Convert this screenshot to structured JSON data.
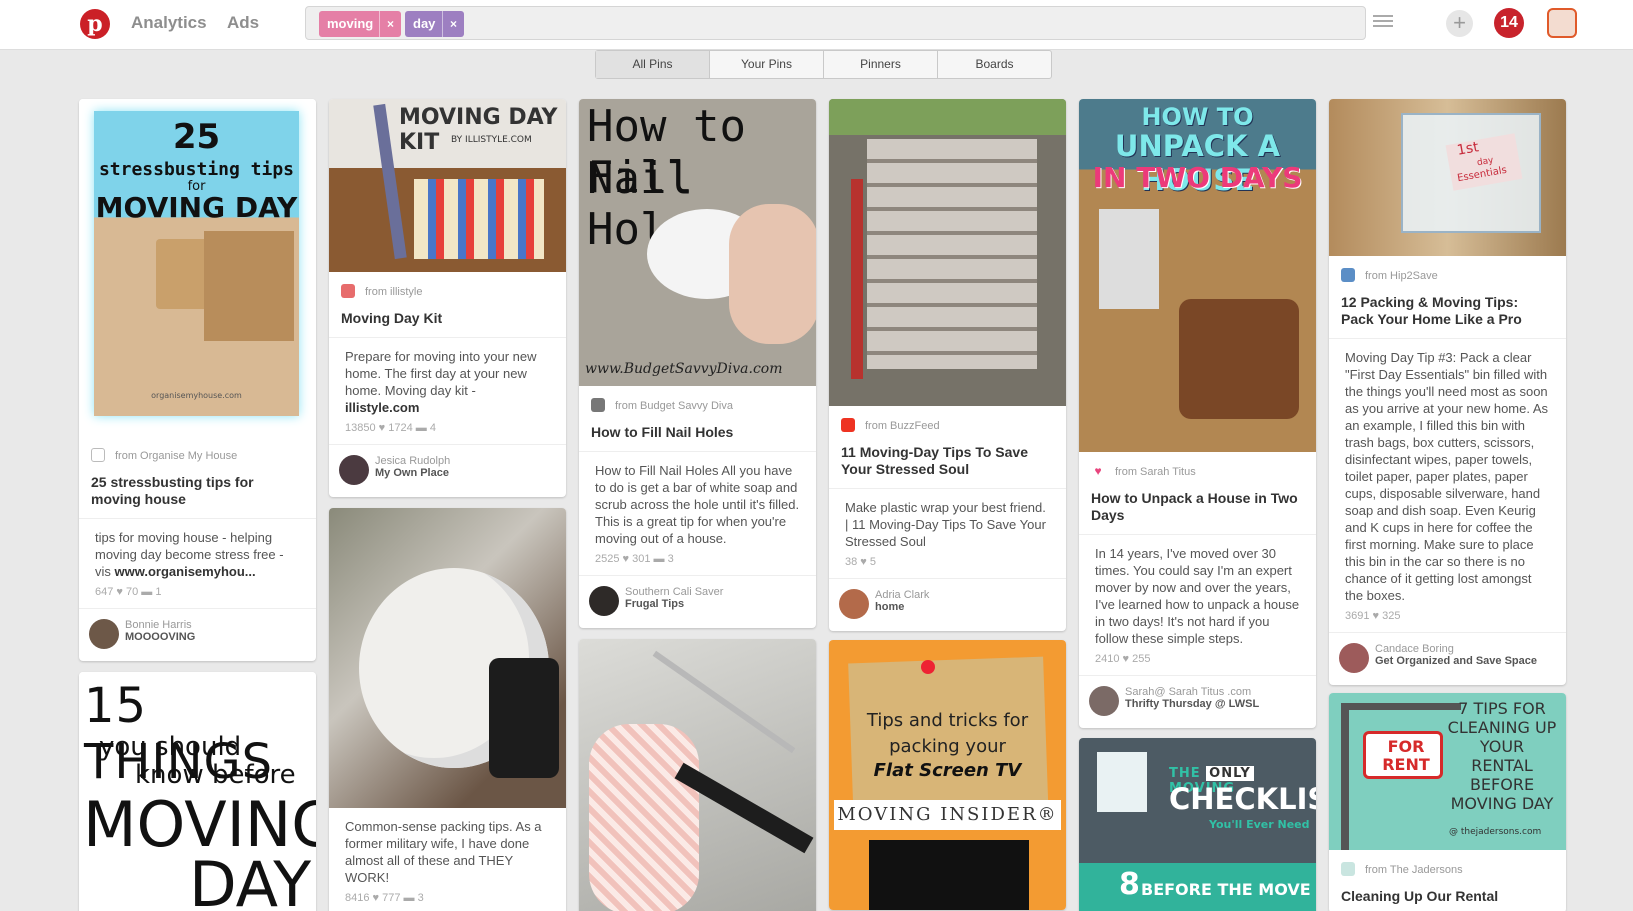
{
  "header": {
    "nav": {
      "analytics": "Analytics",
      "ads": "Ads"
    },
    "search_chips": [
      {
        "label": "moving",
        "color": "#e57fa6"
      },
      {
        "label": "day",
        "color": "#9d7fc1"
      }
    ],
    "notifications": "14",
    "logo_glyph": "p",
    "close_glyph": "×",
    "plus_glyph": "+"
  },
  "tabs": [
    "All Pins",
    "Your Pins",
    "Pinners",
    "Boards"
  ],
  "pins": {
    "p1": {
      "img_title1": "25",
      "img_title2": "stressbusting tips",
      "img_title3": "for",
      "img_title4": "MOVING DAY",
      "img_credit": "organisemyhouse.com",
      "source": "from Organise My House",
      "title": "25 stressbusting tips for moving house",
      "desc": "tips for moving house - helping moving day become stress free - vis ",
      "desc_link": "www.organisemyhou...",
      "stats": "647   ♥ 70   ▬ 1",
      "pinner": "Bonnie Harris",
      "board": "MOOOOVING"
    },
    "p2": {
      "img_title1": "15 THINGS",
      "img_title2": "you should",
      "img_title3": "know before",
      "img_title4": "MOVING",
      "img_title5": "DAY"
    },
    "p3": {
      "img_title1": "MOVING DAY KIT",
      "img_title2": "BY ILLISTYLE.COM",
      "source": "from illistyle",
      "title": "Moving Day Kit",
      "desc": "Prepare for moving into your new home. The first day at your new home. Moving day kit - ",
      "desc_link": "illistyle.com",
      "stats": "13850   ♥ 1724   ▬ 4",
      "pinner": "Jesica Rudolph",
      "board": "My Own Place"
    },
    "p4": {
      "desc": "Common-sense packing tips. As a former military wife, I have done almost all of these and THEY WORK!",
      "stats": "8416   ♥ 777   ▬ 3"
    },
    "p5": {
      "img_title1": "How to Fill",
      "img_title2": "Nail Holes",
      "img_credit": "www.BudgetSavvyDiva.com",
      "source": "from Budget Savvy Diva",
      "title": "How to Fill Nail Holes",
      "desc": "How to Fill Nail Holes All you have to do is get a bar of white soap and scrub across the hole until it's filled. This is a great tip for when you're moving out of a house.",
      "stats": "2525   ♥ 301   ▬ 3",
      "pinner": "Southern Cali Saver",
      "board": "Frugal Tips"
    },
    "p7": {
      "source": "from BuzzFeed",
      "title": "11 Moving-Day Tips To Save Your Stressed Soul",
      "desc": "Make plastic wrap your best friend. | 11 Moving-Day Tips To Save Your Stressed Soul",
      "stats": "38   ♥ 5",
      "pinner": "Adria Clark",
      "board": "home"
    },
    "p8": {
      "img_title1": "Tips and tricks for",
      "img_title2": "packing your",
      "img_title3": "Flat Screen TV",
      "img_title4": "MOVING INSIDER®"
    },
    "p9": {
      "img_title1": "HOW TO",
      "img_title2": "UNPACK A HOUSE",
      "img_title3": "IN TWO DAYS",
      "source": "from Sarah Titus",
      "title": "How to Unpack a House in Two Days",
      "desc": "In 14 years, I've moved over 30 times. You could say I'm an expert mover by now and over the years, I've learned how to unpack a house in two days! It's not hard if you follow these simple steps.",
      "stats": "2410   ♥ 255",
      "pinner": "Sarah@ Sarah Titus .com",
      "board": "Thrifty Thursday @ LWSL"
    },
    "p10": {
      "img_title1": "THE ",
      "img_title1b": "ONLY",
      "img_title1c": " MOVING",
      "img_title2": "CHECKLIST",
      "img_title3": "You'll Ever Need",
      "img_title4": "8",
      "img_title5": "BEFORE THE MOVE"
    },
    "p11": {
      "img_label1": "1st",
      "img_label2": "day",
      "img_label3": "Essentials",
      "source": "from Hip2Save",
      "title": "12 Packing & Moving Tips: Pack Your Home Like a Pro",
      "desc": "Moving Day Tip #3: Pack a clear \"First Day Essentials\" bin filled with the things you'll need most as soon as you arrive at your new home. As an example, I filled this bin with trash bags, box cutters, scissors, disinfectant wipes, paper towels, toilet paper, paper plates, paper cups, disposable silverware, hand soap and dish soap. Even Keurig and K cups in here for coffee the first morning. Make sure to place this bin in the car so there is no chance of it getting lost amongst the boxes.",
      "stats": "3691   ♥ 325",
      "pinner": "Candace Boring",
      "board": "Get Organized and Save Space"
    },
    "p12": {
      "img_title1": "FOR",
      "img_title2": "RENT",
      "img_title3": "7 TIPS FOR CLEANING UP YOUR RENTAL BEFORE MOVING DAY",
      "img_credit": "@ thejadersons.com",
      "source": "from The Jadersons",
      "title": "Cleaning Up Our Rental"
    }
  }
}
